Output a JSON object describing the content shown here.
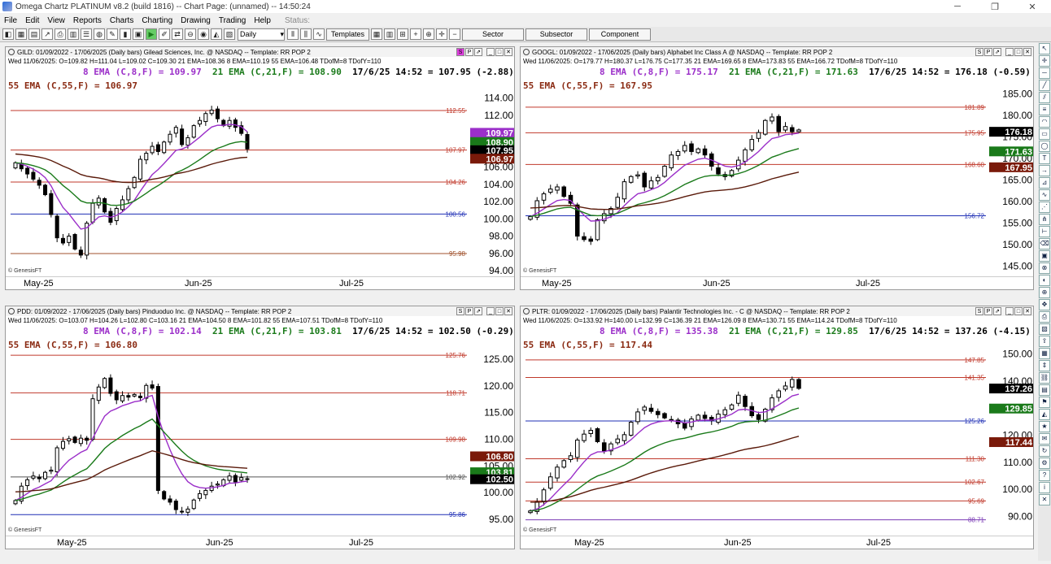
{
  "window": {
    "title": "Omega Chartz PLATINUM v8.2 (build 1816)  --  Chart Page: (unnamed)  --  14:50:24",
    "minimize": "─",
    "restore": "❐",
    "close": "✕"
  },
  "menu": {
    "items": [
      "File",
      "Edit",
      "View",
      "Reports",
      "Charts",
      "Charting",
      "Drawing",
      "Trading",
      "Help"
    ],
    "status_label": "Status:"
  },
  "toolbar": {
    "period": "Daily",
    "templates_label": "Templates",
    "sector_label": "Sector",
    "subsector_label": "Subsector",
    "component_label": "Component"
  },
  "panels": [
    {
      "header": "GILD: 01/09/2022 - 17/06/2025  (Daily bars)  Gilead Sciences, Inc. @ NASDAQ  --  Template: RR POP 2",
      "ohlc": "Wed  11/06/2025:  O=109.82  H=111.04  L=109.02  C=109.30  21 EMA=108.36  8 EMA=110.19  55 EMA=106.48  TDofM=8  TDofY=110",
      "ema8": "8 EMA (C,8,F) = 109.97",
      "ema21": "21 EMA (C,21,F) = 108.90",
      "last": "17/6/25 14:52 = 107.95 (-2.88)",
      "ema55": "55 EMA (C,55,F) = 106.97",
      "copyright": "© GenesisFT",
      "xlabels": [
        "May-25",
        "Jun-25",
        "Jul-25"
      ],
      "yticks": [
        "114.00",
        "112.00",
        "110.00",
        "108.00",
        "106.00",
        "104.00",
        "102.00",
        "100.00",
        "98.00",
        "96.00",
        "94.00"
      ],
      "hlines": [
        {
          "value": "112.55",
          "color": "#c0392b"
        },
        {
          "value": "107.97",
          "color": "#c0392b"
        },
        {
          "value": "104.26",
          "color": "#c0392b"
        },
        {
          "value": "100.56",
          "color": "#1f2fb5"
        },
        {
          "value": "95.98",
          "color": "#a0522d"
        }
      ],
      "tags": [
        {
          "text": "109.97",
          "bg": "#9b2fc9"
        },
        {
          "text": "108.90",
          "bg": "#1a7a1a"
        },
        {
          "text": "107.95",
          "bg": "#000000"
        },
        {
          "text": "106.97",
          "bg": "#7a1a0a"
        }
      ]
    },
    {
      "header": "GOOGL: 01/09/2022 - 17/06/2025  (Daily bars)  Alphabet Inc Class A @ NASDAQ  --  Template: RR POP 2",
      "ohlc": "Wed  11/06/2025:  O=179.77  H=180.37  L=176.75  C=177.35  21 EMA=169.65  8 EMA=173.83  55 EMA=166.72  TDofM=8  TDofY=110",
      "ema8": "8 EMA (C,8,F) = 175.17",
      "ema21": "21 EMA (C,21,F) = 171.63",
      "last": "17/6/25 14:52 = 176.18 (-0.59)",
      "ema55": "55 EMA (C,55,F) = 167.95",
      "copyright": "© GenesisFT",
      "xlabels": [
        "May-25",
        "Jun-25",
        "Jul-25"
      ],
      "yticks": [
        "185.00",
        "180.00",
        "175.00",
        "170.00",
        "165.00",
        "160.00",
        "155.00",
        "150.00",
        "145.00"
      ],
      "hlines": [
        {
          "value": "181.89",
          "color": "#c0392b"
        },
        {
          "value": "175.95",
          "color": "#c0392b"
        },
        {
          "value": "168.60",
          "color": "#c0392b"
        },
        {
          "value": "156.72",
          "color": "#1f2fb5"
        }
      ],
      "tags": [
        {
          "text": "176.18",
          "bg": "#000000"
        },
        {
          "text": "171.63",
          "bg": "#1a7a1a"
        },
        {
          "text": "167.95",
          "bg": "#7a1a0a"
        }
      ]
    },
    {
      "header": "PDD: 01/09/2022 - 17/06/2025  (Daily bars)  Pinduoduo Inc. @ NASDAQ  --  Template: RR POP 2",
      "ohlc": "Wed  11/06/2025:  O=103.07  H=104.26  L=102.80  C=103.16  21 EMA=104.50  8 EMA=101.82  55 EMA=107.51  TDofM=8  TDofY=110",
      "ema8": "8 EMA (C,8,F) = 102.14",
      "ema21": "21 EMA (C,21,F) = 103.81",
      "last": "17/6/25 14:52 = 102.50 (-0.29)",
      "ema55": "55 EMA (C,55,F) = 106.80",
      "copyright": "© GenesisFT",
      "xlabels": [
        "May-25",
        "Jun-25",
        "Jul-25"
      ],
      "yticks": [
        "125.00",
        "120.00",
        "115.00",
        "110.00",
        "105.00",
        "100.00",
        "95.00"
      ],
      "hlines": [
        {
          "value": "125.76",
          "color": "#c0392b"
        },
        {
          "value": "118.71",
          "color": "#c0392b"
        },
        {
          "value": "109.98",
          "color": "#c0392b"
        },
        {
          "value": "102.92",
          "color": "#555555"
        },
        {
          "value": "95.86",
          "color": "#1f2fb5"
        }
      ],
      "tags": [
        {
          "text": "106.80",
          "bg": "#7a1a0a"
        },
        {
          "text": "103.81",
          "bg": "#1a7a1a"
        },
        {
          "text": "102.50",
          "bg": "#000000"
        }
      ]
    },
    {
      "header": "PLTR: 01/09/2022 - 17/06/2025  (Daily bars)  Palantir Technologies Inc. - C @ NASDAQ  --  Template: RR POP 2",
      "ohlc": "Wed  11/06/2025:  O=133.92  H=140.00  L=132.99  C=136.39  21 EMA=126.09  8 EMA=130.71  55 EMA=114.24  TDofM=8  TDofY=110",
      "ema8": "8 EMA (C,8,F) = 135.38",
      "ema21": "21 EMA (C,21,F) = 129.85",
      "last": "17/6/25 14:52 = 137.26 (-4.15)",
      "ema55": "55 EMA (C,55,F) = 117.44",
      "copyright": "© GenesisFT",
      "xlabels": [
        "May-25",
        "Jun-25",
        "Jul-25"
      ],
      "yticks": [
        "150.00",
        "140.00",
        "130.00",
        "120.00",
        "110.00",
        "100.00",
        "90.00"
      ],
      "hlines": [
        {
          "value": "147.85",
          "color": "#c0392b"
        },
        {
          "value": "141.35",
          "color": "#c0392b"
        },
        {
          "value": "125.26",
          "color": "#1f2fb5"
        },
        {
          "value": "111.30",
          "color": "#c0392b"
        },
        {
          "value": "102.67",
          "color": "#c0392b"
        },
        {
          "value": "95.69",
          "color": "#c0392b"
        },
        {
          "value": "88.71",
          "color": "#7a3ab5"
        }
      ],
      "tags": [
        {
          "text": "137.26",
          "bg": "#000000"
        },
        {
          "text": "129.85",
          "bg": "#1a7a1a"
        },
        {
          "text": "117.44",
          "bg": "#7a1a0a"
        }
      ]
    }
  ],
  "chart_data": [
    {
      "type": "candlestick",
      "title": "GILD: 01/09/2022 - 17/06/2025  (Daily bars)  Gilead Sciences, Inc. @ NASDAQ  --  Template: RR POP 2",
      "ylim": [
        94,
        115
      ],
      "closes": [
        106.5,
        105.8,
        105.2,
        104.6,
        103.9,
        102.8,
        100.5,
        97.8,
        97.2,
        98.0,
        96.5,
        95.8,
        99.5,
        101.8,
        102.4,
        100.8,
        99.6,
        101.2,
        102.2,
        103.5,
        104.8,
        106.9,
        107.6,
        108.4,
        107.8,
        108.9,
        109.8,
        110.6,
        108.6,
        109.4,
        110.8,
        111.4,
        112.2,
        112.6,
        111.6,
        110.8,
        111.4,
        110.6,
        109.9,
        108.1
      ],
      "series": [
        {
          "name": "8 EMA (C,8,F)",
          "color": "#9b2fc9"
        },
        {
          "name": "21 EMA (C,21,F)",
          "color": "#1a7a1a"
        },
        {
          "name": "55 EMA (C,55,F)",
          "color": "#5a1a0a"
        }
      ]
    },
    {
      "type": "candlestick",
      "title": "GOOGL: 01/09/2022 - 17/06/2025  (Daily bars)  Alphabet Inc Class A @ NASDAQ  --  Template: RR POP 2",
      "ylim": [
        144,
        186
      ],
      "closes": [
        156.5,
        160.2,
        161.8,
        162.9,
        163.4,
        161.2,
        159.6,
        152.0,
        151.2,
        150.8,
        155.8,
        157.2,
        158.4,
        161.0,
        164.6,
        165.8,
        166.2,
        163.4,
        164.8,
        165.6,
        168.2,
        170.8,
        171.6,
        173.0,
        171.6,
        172.2,
        170.8,
        168.2,
        166.4,
        165.8,
        167.2,
        169.6,
        172.0,
        174.4,
        176.0,
        178.8,
        179.6,
        176.2,
        177.4,
        176.2,
        176.6
      ],
      "series": [
        {
          "name": "8 EMA (C,8,F)",
          "color": "#9b2fc9"
        },
        {
          "name": "21 EMA (C,21,F)",
          "color": "#1a7a1a"
        },
        {
          "name": "55 EMA (C,55,F)",
          "color": "#5a1a0a"
        }
      ]
    },
    {
      "type": "candlestick",
      "title": "PDD: 01/09/2022 - 17/06/2025  (Daily bars)  Pinduoduo Inc. @ NASDAQ  --  Template: RR POP 2",
      "ylim": [
        93,
        127
      ],
      "closes": [
        98.5,
        101.2,
        102.4,
        103.1,
        102.6,
        103.8,
        104.2,
        108.4,
        109.6,
        110.1,
        109.4,
        110.2,
        109.8,
        117.6,
        119.8,
        121.4,
        118.6,
        117.4,
        118.2,
        117.9,
        118.4,
        117.8,
        120.1,
        119.6,
        100.4,
        98.8,
        98.2,
        96.8,
        96.4,
        96.9,
        98.6,
        99.8,
        100.4,
        101.2,
        101.6,
        102.4,
        103.1,
        102.0,
        102.8,
        102.5
      ],
      "series": [
        {
          "name": "8 EMA (C,8,F)",
          "color": "#9b2fc9"
        },
        {
          "name": "21 EMA (C,21,F)",
          "color": "#1a7a1a"
        },
        {
          "name": "55 EMA (C,55,F)",
          "color": "#5a1a0a"
        }
      ]
    },
    {
      "type": "candlestick",
      "title": "PLTR: 01/09/2022 - 17/06/2025  (Daily bars)  Palantir Technologies Inc. - C @ NASDAQ  --  Template: RR POP 2",
      "ylim": [
        85,
        152
      ],
      "closes": [
        92.0,
        95.4,
        99.8,
        104.6,
        108.2,
        110.6,
        112.4,
        118.2,
        120.4,
        121.8,
        117.6,
        114.2,
        116.8,
        118.6,
        120.2,
        124.8,
        128.6,
        130.4,
        128.8,
        127.6,
        126.4,
        125.8,
        124.2,
        122.6,
        126.0,
        127.4,
        126.2,
        125.4,
        127.8,
        129.4,
        131.2,
        134.8,
        130.6,
        127.2,
        125.8,
        129.6,
        133.8,
        136.4,
        138.2,
        140.6,
        137.3
      ],
      "series": [
        {
          "name": "8 EMA (C,8,F)",
          "color": "#9b2fc9"
        },
        {
          "name": "21 EMA (C,21,F)",
          "color": "#1a7a1a"
        },
        {
          "name": "55 EMA (C,55,F)",
          "color": "#5a1a0a"
        }
      ]
    }
  ],
  "sidebar_icons": [
    "cursor-icon",
    "crosshair-icon",
    "hline-icon",
    "trendline-icon",
    "channel-icon",
    "fib-icon",
    "arc-icon",
    "rect-icon",
    "ellipse-icon",
    "text-icon",
    "arrow-icon",
    "gann-icon",
    "cycle-icon",
    "speed-icon",
    "pitchfork-icon",
    "ruler-icon",
    "erase-icon",
    "lock-icon",
    "magnet-icon",
    "palette-icon",
    "zoom-icon",
    "pan-icon",
    "print-icon",
    "save-icon",
    "export-icon",
    "grid-icon",
    "scale-icon",
    "link-icon",
    "layout-icon",
    "flag-icon",
    "bell-icon",
    "star-icon",
    "note-icon",
    "refresh-icon",
    "settings-icon",
    "help-icon",
    "info-icon",
    "close-icon"
  ]
}
